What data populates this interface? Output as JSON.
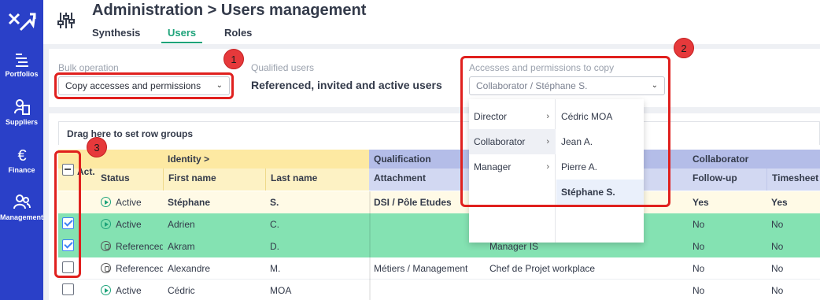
{
  "nav": {
    "items": [
      {
        "label": "Portfolios",
        "icon": "portfolios-icon"
      },
      {
        "label": "Suppliers",
        "icon": "suppliers-icon"
      },
      {
        "label": "Finance",
        "icon": "euro-icon"
      },
      {
        "label": "Management",
        "icon": "management-icon"
      }
    ]
  },
  "header": {
    "title": "Administration > Users management",
    "tabs": [
      {
        "label": "Synthesis",
        "active": false
      },
      {
        "label": "Users",
        "active": true
      },
      {
        "label": "Roles",
        "active": false
      }
    ]
  },
  "toolbar": {
    "bulk_label": "Bulk operation",
    "bulk_value": "Copy accesses and permissions",
    "qualified_label": "Qualified users",
    "qualified_value": "Referenced, invited and active users",
    "copy_label": "Accesses and permissions to copy",
    "copy_value": "Collaborator / Stéphane S."
  },
  "cascade": {
    "roles": [
      {
        "label": "Director",
        "selected": false
      },
      {
        "label": "Collaborator",
        "selected": true
      },
      {
        "label": "Manager",
        "selected": false
      }
    ],
    "users": [
      {
        "label": "Cédric MOA",
        "selected": false
      },
      {
        "label": "Jean A.",
        "selected": false
      },
      {
        "label": "Pierre A.",
        "selected": false
      },
      {
        "label": "Stéphane S.",
        "selected": true
      }
    ]
  },
  "grid": {
    "rowgroup_hint": "Drag here to set row groups",
    "group_headers": {
      "identity": "Identity >",
      "qualification": "Qualification",
      "collaborator": "Collaborator"
    },
    "columns": {
      "act": "Act.",
      "status": "Status",
      "first_name": "First name",
      "last_name": "Last name",
      "attachment": "Attachment",
      "follow_up": "Follow-up",
      "timesheet": "Timesheet"
    },
    "rows": [
      {
        "status": "Active",
        "first": "Stéphane",
        "last": "S.",
        "attachment": "DSI / Pôle Etudes",
        "role": "",
        "follow": "Yes",
        "timesheet": "Yes"
      },
      {
        "status": "Active",
        "first": "Adrien",
        "last": "C.",
        "attachment": "",
        "role": "",
        "follow": "No",
        "timesheet": "No"
      },
      {
        "status": "Referenced",
        "first": "Akram",
        "last": "D.",
        "attachment": "",
        "role": "Manager IS",
        "follow": "No",
        "timesheet": "No"
      },
      {
        "status": "Referenced",
        "first": "Alexandre",
        "last": "M.",
        "attachment": "Métiers / Management",
        "role": "Chef de Projet workplace",
        "follow": "No",
        "timesheet": "No"
      },
      {
        "status": "Active",
        "first": "Cédric",
        "last": "MOA",
        "attachment": "",
        "role": "",
        "follow": "No",
        "timesheet": "No"
      }
    ]
  },
  "annotations": {
    "badge1": "1",
    "badge2": "2",
    "badge3": "3"
  },
  "colors": {
    "nav_bg": "#2a40c8",
    "accent": "#1ea37a",
    "row_selected": "#84e2b2",
    "annotation": "#e0201e"
  }
}
